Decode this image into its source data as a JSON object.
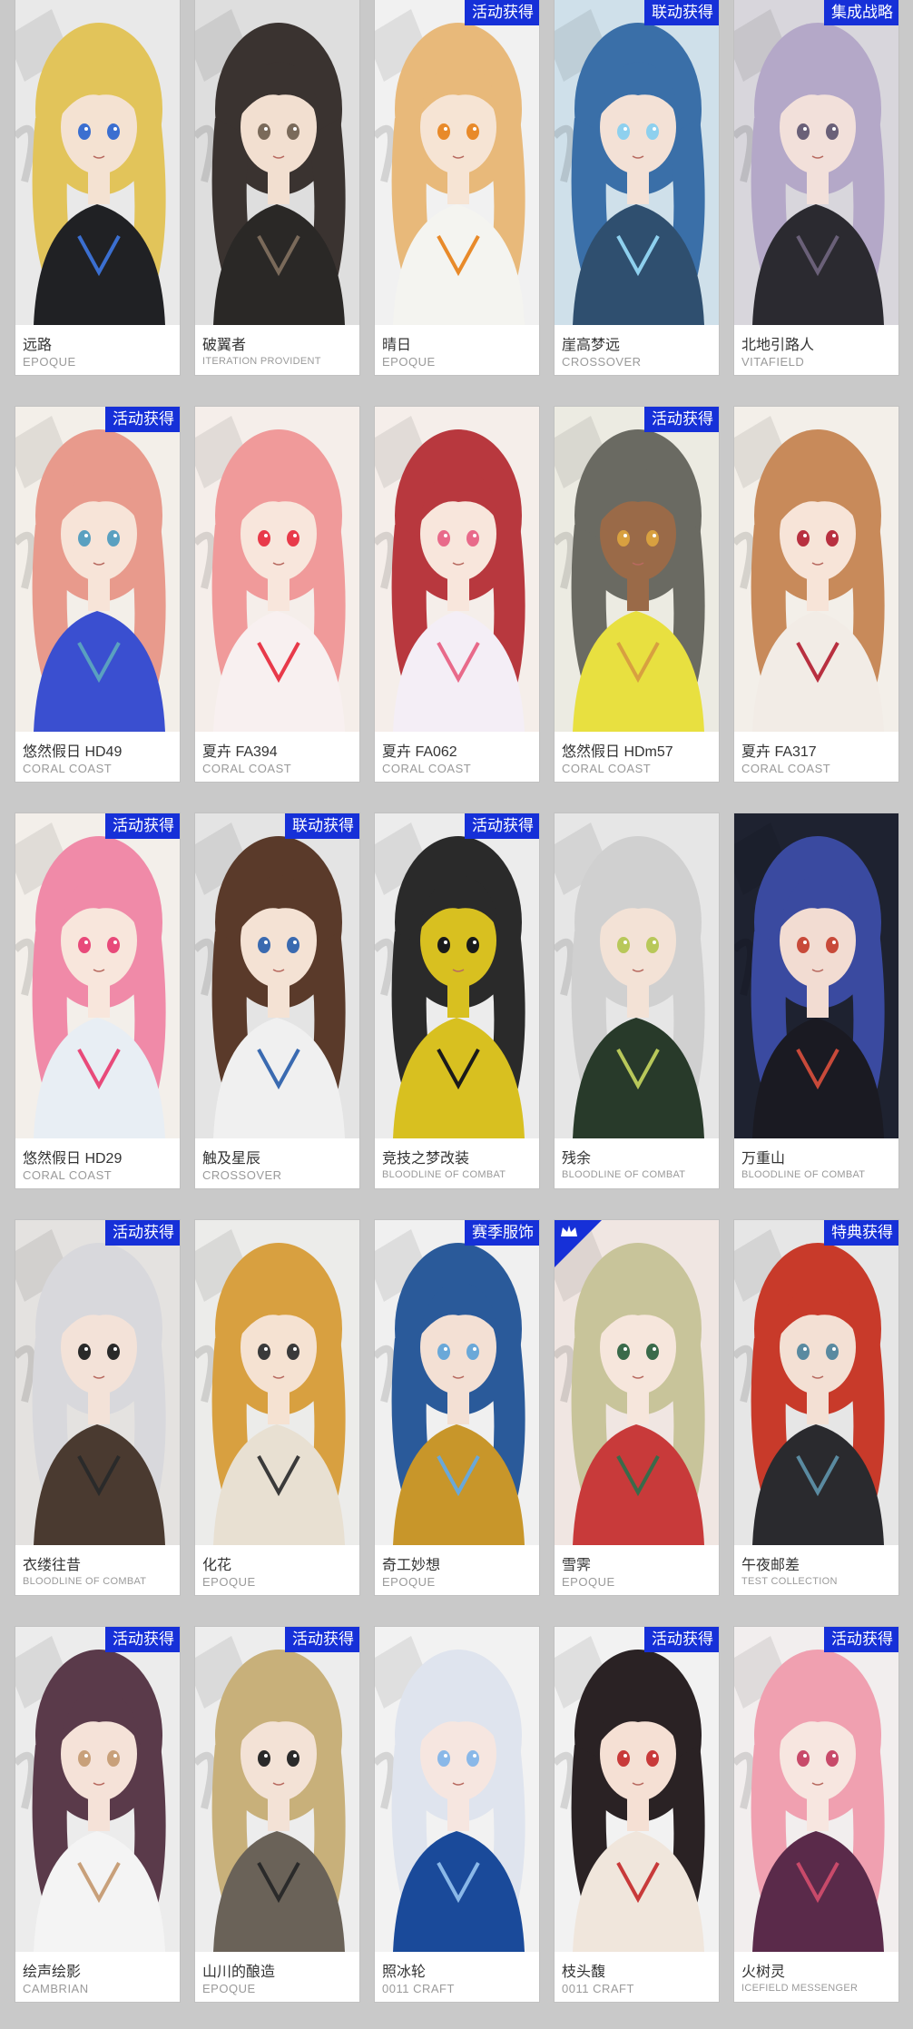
{
  "cards": [
    {
      "name": "远路",
      "series": "EPOQUE",
      "badge": "",
      "corner": false,
      "palette": {
        "bg": "#e9e9e9",
        "hair": "#e2c45a",
        "coat": "#202124",
        "accent": "#3b6fd0",
        "skin": "#f4e2d2"
      }
    },
    {
      "name": "破翼者",
      "series": "ITERATION PROVIDENT",
      "badge": "",
      "corner": false,
      "palette": {
        "bg": "#dedede",
        "hair": "#3a3330",
        "coat": "#2a2826",
        "accent": "#7a6a5a",
        "skin": "#f2dfd0"
      }
    },
    {
      "name": "晴日",
      "series": "EPOQUE",
      "badge": "活动获得",
      "corner": false,
      "palette": {
        "bg": "#f1f1f1",
        "hair": "#e8b97a",
        "coat": "#f4f4f0",
        "accent": "#e88a2a",
        "skin": "#f6e4d4"
      }
    },
    {
      "name": "崖高梦远",
      "series": "CROSSOVER",
      "badge": "联动获得",
      "corner": false,
      "palette": {
        "bg": "#cfe0ea",
        "hair": "#3a6fa8",
        "coat": "#2f4f6f",
        "accent": "#8ed0ee",
        "skin": "#f3e1d6"
      }
    },
    {
      "name": "北地引路人",
      "series": "VITAFIELD",
      "badge": "集成战略",
      "corner": false,
      "palette": {
        "bg": "#d8d6dc",
        "hair": "#b4a8c8",
        "coat": "#2b2a30",
        "accent": "#6a6078",
        "skin": "#f2e0da"
      }
    },
    {
      "name": "悠然假日 HD49",
      "series": "CORAL COAST",
      "badge": "活动获得",
      "corner": false,
      "palette": {
        "bg": "#f3efe9",
        "hair": "#e89a8c",
        "coat": "#3a4fd0",
        "accent": "#5aa0c0",
        "skin": "#f7e4d8"
      }
    },
    {
      "name": "夏卉 FA394",
      "series": "CORAL COAST",
      "badge": "",
      "corner": false,
      "palette": {
        "bg": "#f5eeea",
        "hair": "#f09a9a",
        "coat": "#f8f0f0",
        "accent": "#e83a4a",
        "skin": "#f8e6dc"
      }
    },
    {
      "name": "夏卉 FA062",
      "series": "CORAL COAST",
      "badge": "",
      "corner": false,
      "palette": {
        "bg": "#f5eeea",
        "hair": "#b8383e",
        "coat": "#f4eef6",
        "accent": "#e86a8a",
        "skin": "#f8e6dc"
      }
    },
    {
      "name": "悠然假日 HDm57",
      "series": "CORAL COAST",
      "badge": "活动获得",
      "corner": false,
      "palette": {
        "bg": "#ecebe2",
        "hair": "#6a6a62",
        "coat": "#e8e040",
        "accent": "#d8a040",
        "skin": "#9a6a48"
      }
    },
    {
      "name": "夏卉 FA317",
      "series": "CORAL COAST",
      "badge": "",
      "corner": false,
      "palette": {
        "bg": "#f3efe9",
        "hair": "#c88a5a",
        "coat": "#f2ece6",
        "accent": "#b83040",
        "skin": "#f7e4d8"
      }
    },
    {
      "name": "悠然假日 HD29",
      "series": "CORAL COAST",
      "badge": "活动获得",
      "corner": false,
      "palette": {
        "bg": "#f3efea",
        "hair": "#f08aa8",
        "coat": "#e8eef4",
        "accent": "#e84a7a",
        "skin": "#f8e6dc"
      }
    },
    {
      "name": "触及星辰",
      "series": "CROSSOVER",
      "badge": "联动获得",
      "corner": false,
      "palette": {
        "bg": "#e4e4e4",
        "hair": "#5a3a2a",
        "coat": "#f0f0f0",
        "accent": "#3a6ab0",
        "skin": "#f4e2d4"
      }
    },
    {
      "name": "竞技之梦改装",
      "series": "BLOODLINE OF COMBAT",
      "badge": "活动获得",
      "corner": false,
      "palette": {
        "bg": "#ececec",
        "hair": "#2a2a2a",
        "coat": "#d8c020",
        "accent": "#1a1a1a",
        "skin": "#d8c020"
      }
    },
    {
      "name": "残余",
      "series": "BLOODLINE OF COMBAT",
      "badge": "",
      "corner": false,
      "palette": {
        "bg": "#e6e6e6",
        "hair": "#d0d0d0",
        "coat": "#283a2a",
        "accent": "#b8c85a",
        "skin": "#f3e2d6"
      }
    },
    {
      "name": "万重山",
      "series": "BLOODLINE OF COMBAT",
      "badge": "",
      "corner": false,
      "palette": {
        "bg": "#1e2230",
        "hair": "#3a4aa0",
        "coat": "#1a1a22",
        "accent": "#c84a3a",
        "skin": "#f2dcd2"
      }
    },
    {
      "name": "衣缕往昔",
      "series": "BLOODLINE OF COMBAT",
      "badge": "活动获得",
      "corner": false,
      "palette": {
        "bg": "#e4e2e0",
        "hair": "#d8d8dc",
        "coat": "#4a3a30",
        "accent": "#2a2a2a",
        "skin": "#f3e2d8"
      }
    },
    {
      "name": "化花",
      "series": "EPOQUE",
      "badge": "",
      "corner": false,
      "palette": {
        "bg": "#ececea",
        "hair": "#d8a040",
        "coat": "#e8e0d2",
        "accent": "#3a3a3a",
        "skin": "#f5e2d2"
      }
    },
    {
      "name": "奇工妙想",
      "series": "EPOQUE",
      "badge": "赛季服饰",
      "corner": false,
      "palette": {
        "bg": "#f0f0f0",
        "hair": "#2a5a9a",
        "coat": "#c8962a",
        "accent": "#6aa8d8",
        "skin": "#f3e0d4"
      }
    },
    {
      "name": "雪霁",
      "series": "EPOQUE",
      "badge": "",
      "corner": true,
      "palette": {
        "bg": "#f0e6e2",
        "hair": "#c8c49a",
        "coat": "#c83a3a",
        "accent": "#3a6a4a",
        "skin": "#f6e6dc"
      }
    },
    {
      "name": "午夜邮差",
      "series": "TEST COLLECTION",
      "badge": "特典获得",
      "corner": false,
      "palette": {
        "bg": "#e6e6e6",
        "hair": "#c83a2a",
        "coat": "#2a2a2e",
        "accent": "#5a8aa0",
        "skin": "#f3e0d4"
      }
    },
    {
      "name": "绘声绘影",
      "series": "CAMBRIAN",
      "badge": "活动获得",
      "corner": false,
      "palette": {
        "bg": "#ececec",
        "hair": "#5a3a4a",
        "coat": "#f4f4f4",
        "accent": "#c8a07a",
        "skin": "#f5e2d8"
      }
    },
    {
      "name": "山川的酿造",
      "series": "EPOQUE",
      "badge": "活动获得",
      "corner": false,
      "palette": {
        "bg": "#ededed",
        "hair": "#c8b07a",
        "coat": "#6a6258",
        "accent": "#2a2a2a",
        "skin": "#f3e2d6"
      }
    },
    {
      "name": "照冰轮",
      "series": "0011 CRAFT",
      "badge": "",
      "corner": false,
      "palette": {
        "bg": "#f2f2f2",
        "hair": "#dfe4ee",
        "coat": "#1a4a9a",
        "accent": "#8ab8e8",
        "skin": "#f6e6e0"
      }
    },
    {
      "name": "枝头馥",
      "series": "0011 CRAFT",
      "badge": "活动获得",
      "corner": false,
      "palette": {
        "bg": "#f2f2f2",
        "hair": "#2a2224",
        "coat": "#f0e6dc",
        "accent": "#c83a3a",
        "skin": "#f5e0d4"
      }
    },
    {
      "name": "火树灵",
      "series": "ICEFIELD MESSENGER",
      "badge": "活动获得",
      "corner": false,
      "palette": {
        "bg": "#f2eeee",
        "hair": "#f0a0b0",
        "coat": "#5a2a4a",
        "accent": "#c84a6a",
        "skin": "#f7e6e0"
      }
    }
  ]
}
